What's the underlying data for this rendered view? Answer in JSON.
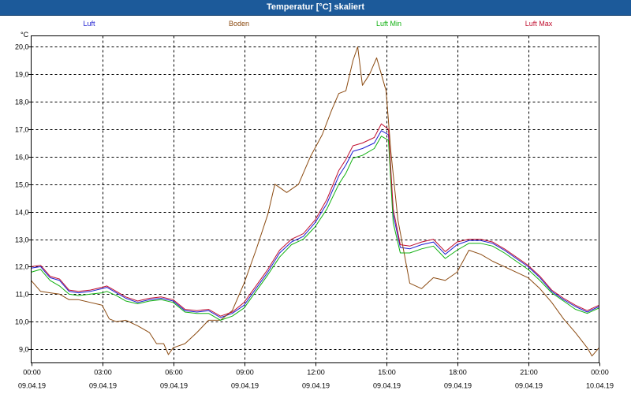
{
  "window": {
    "title": "Temperatur [°C] skaliert"
  },
  "colors": {
    "titlebar": "#1c5a9a",
    "luft": "#1c1cd0",
    "boden": "#8b4a10",
    "luft_min": "#10b010",
    "luft_max": "#c01030",
    "grid": "#000000"
  },
  "chart_data": {
    "type": "line",
    "ylabel": "°C",
    "ylim": [
      8.5,
      20.4
    ],
    "xlim": [
      0,
      24
    ],
    "y_ticks": [
      "20,0",
      "19,0",
      "18,0",
      "17,0",
      "16,0",
      "15,0",
      "14,0",
      "13,0",
      "12,0",
      "11,0",
      "10,0",
      "9,0"
    ],
    "y_tick_values": [
      20,
      19,
      18,
      17,
      16,
      15,
      14,
      13,
      12,
      11,
      10,
      9
    ],
    "x_tick_values": [
      0,
      3,
      6,
      9,
      12,
      15,
      18,
      21,
      24
    ],
    "x_ticks": [
      {
        "time": "00:00",
        "date": "09.04.19"
      },
      {
        "time": "03:00",
        "date": "09.04.19"
      },
      {
        "time": "06:00",
        "date": "09.04.19"
      },
      {
        "time": "09:00",
        "date": "09.04.19"
      },
      {
        "time": "12:00",
        "date": "09.04.19"
      },
      {
        "time": "15:00",
        "date": "09.04.19"
      },
      {
        "time": "18:00",
        "date": "09.04.19"
      },
      {
        "time": "21:00",
        "date": "09.04.19"
      },
      {
        "time": "00:00",
        "date": "10.04.19"
      }
    ],
    "grid": true,
    "legend": "top",
    "series": [
      {
        "name": "Luft",
        "color": "#1c1cd0",
        "points": [
          [
            0,
            11.95
          ],
          [
            0.4,
            12.0
          ],
          [
            0.8,
            11.6
          ],
          [
            1.2,
            11.5
          ],
          [
            1.6,
            11.1
          ],
          [
            2.0,
            11.05
          ],
          [
            2.5,
            11.1
          ],
          [
            3.0,
            11.2
          ],
          [
            3.2,
            11.25
          ],
          [
            3.6,
            11.05
          ],
          [
            4.0,
            10.85
          ],
          [
            4.5,
            10.7
          ],
          [
            5.0,
            10.8
          ],
          [
            5.5,
            10.85
          ],
          [
            6.0,
            10.75
          ],
          [
            6.5,
            10.4
          ],
          [
            7.0,
            10.35
          ],
          [
            7.5,
            10.4
          ],
          [
            8.0,
            10.15
          ],
          [
            8.5,
            10.3
          ],
          [
            9.0,
            10.6
          ],
          [
            9.5,
            11.2
          ],
          [
            10.0,
            11.8
          ],
          [
            10.5,
            12.5
          ],
          [
            11.0,
            12.9
          ],
          [
            11.5,
            13.1
          ],
          [
            12.0,
            13.6
          ],
          [
            12.5,
            14.3
          ],
          [
            13.0,
            15.3
          ],
          [
            13.3,
            15.7
          ],
          [
            13.6,
            16.2
          ],
          [
            14.0,
            16.3
          ],
          [
            14.5,
            16.5
          ],
          [
            14.8,
            16.95
          ],
          [
            15.1,
            16.8
          ],
          [
            15.3,
            13.9
          ],
          [
            15.6,
            12.7
          ],
          [
            16.0,
            12.65
          ],
          [
            16.5,
            12.8
          ],
          [
            17.0,
            12.9
          ],
          [
            17.5,
            12.45
          ],
          [
            18.0,
            12.8
          ],
          [
            18.5,
            12.95
          ],
          [
            19.0,
            12.95
          ],
          [
            19.5,
            12.85
          ],
          [
            20.0,
            12.6
          ],
          [
            20.5,
            12.3
          ],
          [
            21.0,
            12.0
          ],
          [
            21.5,
            11.6
          ],
          [
            22.0,
            11.1
          ],
          [
            22.5,
            10.8
          ],
          [
            23.0,
            10.55
          ],
          [
            23.5,
            10.35
          ],
          [
            24.0,
            10.55
          ]
        ]
      },
      {
        "name": "Boden",
        "color": "#8b4a10",
        "points": [
          [
            0,
            11.5
          ],
          [
            0.4,
            11.1
          ],
          [
            0.8,
            11.05
          ],
          [
            1.2,
            11.0
          ],
          [
            1.6,
            10.8
          ],
          [
            2.0,
            10.8
          ],
          [
            2.5,
            10.7
          ],
          [
            3.0,
            10.6
          ],
          [
            3.3,
            10.1
          ],
          [
            3.6,
            10.0
          ],
          [
            4.0,
            10.05
          ],
          [
            4.5,
            9.85
          ],
          [
            5.0,
            9.6
          ],
          [
            5.3,
            9.2
          ],
          [
            5.6,
            9.2
          ],
          [
            5.8,
            8.8
          ],
          [
            6.0,
            9.05
          ],
          [
            6.5,
            9.2
          ],
          [
            7.0,
            9.6
          ],
          [
            7.5,
            10.05
          ],
          [
            8.0,
            10.05
          ],
          [
            8.5,
            10.4
          ],
          [
            9.0,
            11.4
          ],
          [
            9.5,
            12.6
          ],
          [
            10.0,
            13.9
          ],
          [
            10.3,
            15.0
          ],
          [
            10.8,
            14.7
          ],
          [
            11.3,
            15.0
          ],
          [
            11.8,
            16.0
          ],
          [
            12.3,
            16.8
          ],
          [
            12.7,
            17.7
          ],
          [
            13.0,
            18.3
          ],
          [
            13.3,
            18.4
          ],
          [
            13.6,
            19.5
          ],
          [
            13.8,
            20.0
          ],
          [
            14.0,
            18.6
          ],
          [
            14.3,
            19.0
          ],
          [
            14.6,
            19.6
          ],
          [
            15.0,
            18.4
          ],
          [
            15.2,
            16.2
          ],
          [
            15.5,
            13.7
          ],
          [
            16.0,
            11.4
          ],
          [
            16.5,
            11.2
          ],
          [
            17.0,
            11.6
          ],
          [
            17.5,
            11.5
          ],
          [
            18.0,
            11.8
          ],
          [
            18.5,
            12.6
          ],
          [
            19.0,
            12.45
          ],
          [
            19.5,
            12.2
          ],
          [
            20.0,
            12.0
          ],
          [
            20.5,
            11.8
          ],
          [
            21.0,
            11.6
          ],
          [
            21.5,
            11.2
          ],
          [
            22.0,
            10.7
          ],
          [
            22.5,
            10.1
          ],
          [
            23.0,
            9.6
          ],
          [
            23.5,
            9.05
          ],
          [
            23.7,
            8.75
          ],
          [
            24.0,
            9.05
          ]
        ]
      },
      {
        "name": "Luft Min",
        "color": "#10b010",
        "points": [
          [
            0,
            11.8
          ],
          [
            0.4,
            11.9
          ],
          [
            0.8,
            11.5
          ],
          [
            1.2,
            11.3
          ],
          [
            1.6,
            11.0
          ],
          [
            2.0,
            10.95
          ],
          [
            2.5,
            11.0
          ],
          [
            3.0,
            11.05
          ],
          [
            3.2,
            11.1
          ],
          [
            3.6,
            10.95
          ],
          [
            4.0,
            10.75
          ],
          [
            4.5,
            10.65
          ],
          [
            5.0,
            10.75
          ],
          [
            5.5,
            10.8
          ],
          [
            6.0,
            10.7
          ],
          [
            6.5,
            10.35
          ],
          [
            7.0,
            10.3
          ],
          [
            7.5,
            10.3
          ],
          [
            8.0,
            10.05
          ],
          [
            8.5,
            10.2
          ],
          [
            9.0,
            10.5
          ],
          [
            9.5,
            11.1
          ],
          [
            10.0,
            11.7
          ],
          [
            10.5,
            12.35
          ],
          [
            11.0,
            12.8
          ],
          [
            11.5,
            13.0
          ],
          [
            12.0,
            13.45
          ],
          [
            12.5,
            14.1
          ],
          [
            13.0,
            15.0
          ],
          [
            13.3,
            15.4
          ],
          [
            13.6,
            15.95
          ],
          [
            14.0,
            16.05
          ],
          [
            14.5,
            16.3
          ],
          [
            14.8,
            16.75
          ],
          [
            15.1,
            16.6
          ],
          [
            15.3,
            13.6
          ],
          [
            15.6,
            12.5
          ],
          [
            16.0,
            12.5
          ],
          [
            16.5,
            12.65
          ],
          [
            17.0,
            12.75
          ],
          [
            17.5,
            12.3
          ],
          [
            18.0,
            12.6
          ],
          [
            18.5,
            12.85
          ],
          [
            19.0,
            12.85
          ],
          [
            19.5,
            12.75
          ],
          [
            20.0,
            12.5
          ],
          [
            20.5,
            12.2
          ],
          [
            21.0,
            11.9
          ],
          [
            21.5,
            11.5
          ],
          [
            22.0,
            11.05
          ],
          [
            22.5,
            10.75
          ],
          [
            23.0,
            10.45
          ],
          [
            23.5,
            10.3
          ],
          [
            24.0,
            10.5
          ]
        ]
      },
      {
        "name": "Luft Max",
        "color": "#c01030",
        "points": [
          [
            0,
            12.0
          ],
          [
            0.4,
            12.05
          ],
          [
            0.8,
            11.65
          ],
          [
            1.2,
            11.55
          ],
          [
            1.6,
            11.15
          ],
          [
            2.0,
            11.1
          ],
          [
            2.5,
            11.15
          ],
          [
            3.0,
            11.25
          ],
          [
            3.2,
            11.3
          ],
          [
            3.6,
            11.1
          ],
          [
            4.0,
            10.9
          ],
          [
            4.5,
            10.75
          ],
          [
            5.0,
            10.85
          ],
          [
            5.5,
            10.9
          ],
          [
            6.0,
            10.8
          ],
          [
            6.5,
            10.45
          ],
          [
            7.0,
            10.4
          ],
          [
            7.5,
            10.45
          ],
          [
            8.0,
            10.2
          ],
          [
            8.5,
            10.35
          ],
          [
            9.0,
            10.7
          ],
          [
            9.5,
            11.3
          ],
          [
            10.0,
            11.9
          ],
          [
            10.5,
            12.6
          ],
          [
            11.0,
            13.0
          ],
          [
            11.5,
            13.2
          ],
          [
            12.0,
            13.7
          ],
          [
            12.5,
            14.45
          ],
          [
            13.0,
            15.5
          ],
          [
            13.3,
            15.9
          ],
          [
            13.6,
            16.4
          ],
          [
            14.0,
            16.5
          ],
          [
            14.5,
            16.7
          ],
          [
            14.8,
            17.2
          ],
          [
            15.1,
            17.0
          ],
          [
            15.3,
            14.1
          ],
          [
            15.6,
            12.8
          ],
          [
            16.0,
            12.75
          ],
          [
            16.5,
            12.9
          ],
          [
            17.0,
            13.0
          ],
          [
            17.5,
            12.55
          ],
          [
            18.0,
            12.9
          ],
          [
            18.5,
            13.0
          ],
          [
            19.0,
            13.0
          ],
          [
            19.5,
            12.9
          ],
          [
            20.0,
            12.65
          ],
          [
            20.5,
            12.35
          ],
          [
            21.0,
            12.05
          ],
          [
            21.5,
            11.65
          ],
          [
            22.0,
            11.15
          ],
          [
            22.5,
            10.85
          ],
          [
            23.0,
            10.6
          ],
          [
            23.5,
            10.4
          ],
          [
            24.0,
            10.6
          ]
        ]
      }
    ]
  }
}
